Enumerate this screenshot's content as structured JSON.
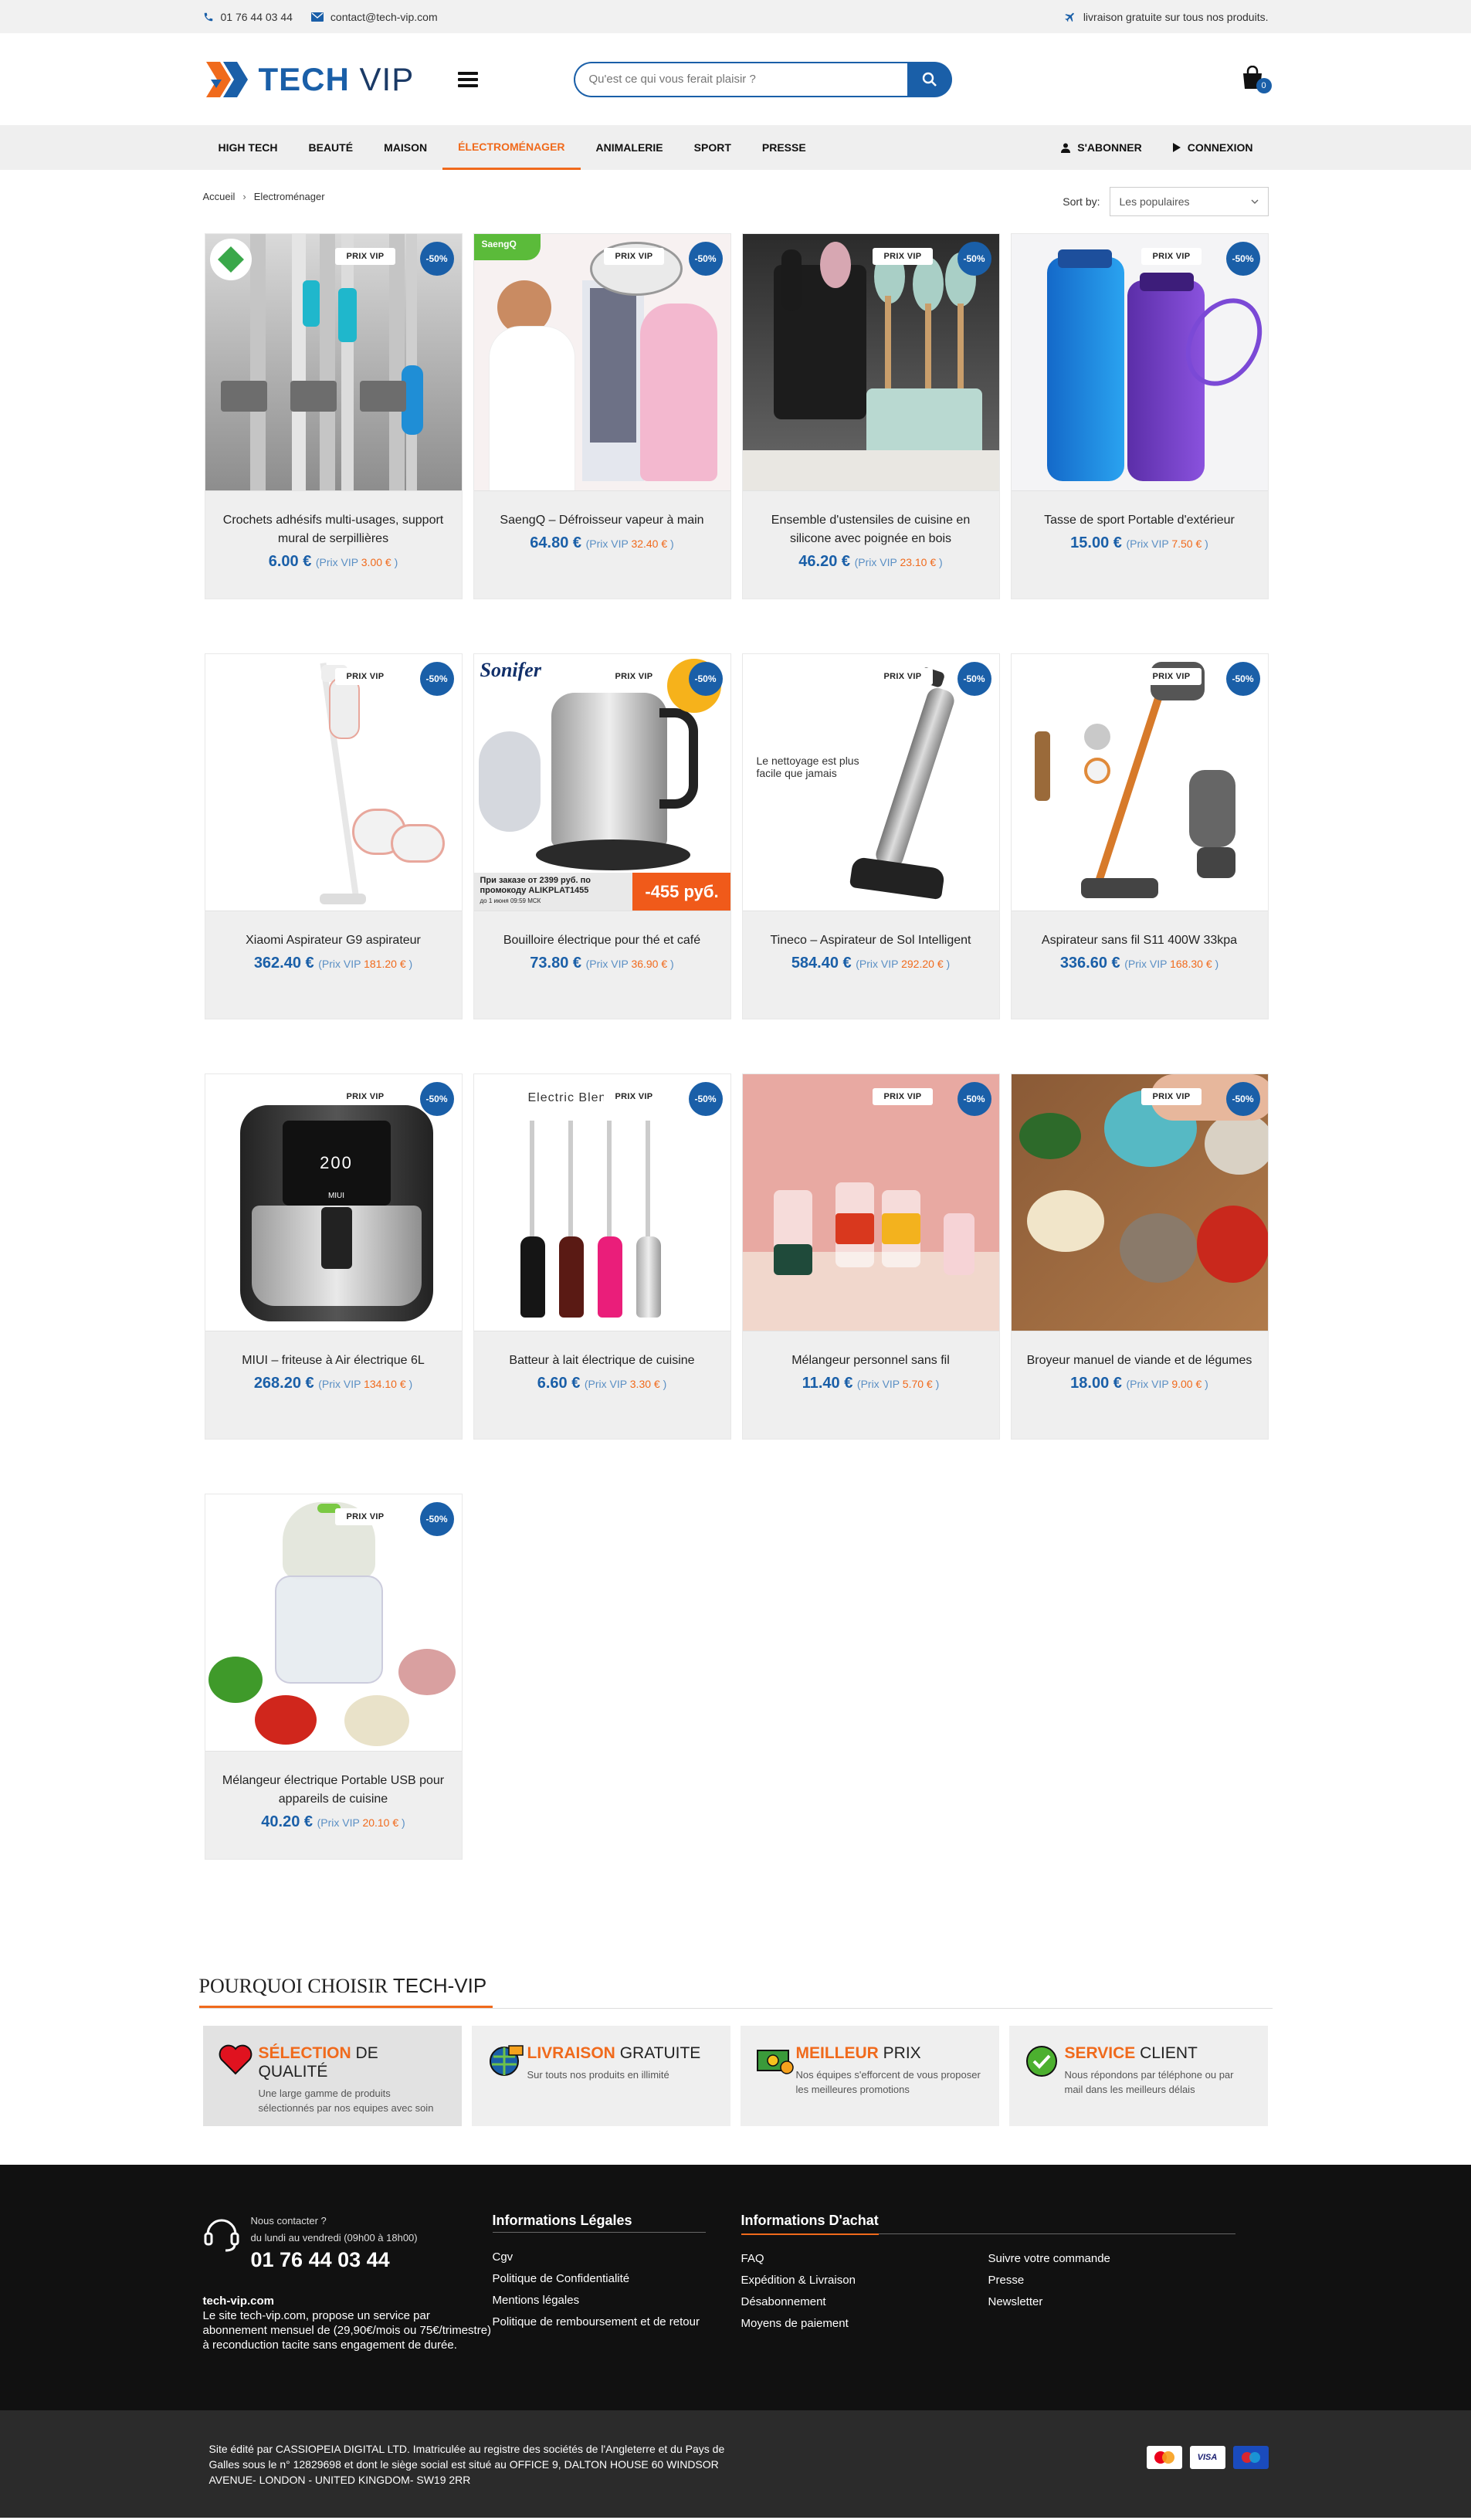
{
  "topbar": {
    "phone": "01 76 44 03 44",
    "email": "contact@tech-vip.com",
    "shipping": "livraison gratuite sur tous nos produits."
  },
  "header": {
    "logo_main": "TECH",
    "logo_sub": "VIP",
    "search_placeholder": "Qu'est ce qui vous ferait plaisir ?",
    "cart_count": "0"
  },
  "nav": {
    "items": [
      "HIGH TECH",
      "BEAUTÉ",
      "MAISON",
      "ÉLECTROMÉNAGER",
      "ANIMALERIE",
      "SPORT",
      "PRESSE"
    ],
    "active": "ÉLECTROMÉNAGER",
    "subscribe": "S'ABONNER",
    "login": "CONNEXION"
  },
  "breadcrumb": {
    "home": "Accueil",
    "sep": "›",
    "current": "Electroménager"
  },
  "sort": {
    "label": "Sort by:",
    "value": "Les populaires"
  },
  "product_labels": {
    "tag": "PRIX VIP",
    "discount": "-50%",
    "vip_prefix": "(Prix VIP",
    "vip_suffix": ")"
  },
  "products": [
    {
      "name": "Crochets adhésifs multi-usages, support mural de serpillières",
      "price": "6.00 €",
      "vip": "3.00 €",
      "img": "hooks"
    },
    {
      "name": "SaengQ – Défroisseur vapeur à main",
      "price": "64.80 €",
      "vip": "32.40 €",
      "img": "steamer"
    },
    {
      "name": "Ensemble d'ustensiles de cuisine en silicone avec poignée en bois",
      "price": "46.20 €",
      "vip": "23.10 €",
      "img": "utensils"
    },
    {
      "name": "Tasse de sport Portable d'extérieur",
      "price": "15.00 €",
      "vip": "7.50 €",
      "img": "bottles"
    },
    {
      "name": "Xiaomi Aspirateur G9 aspirateur",
      "price": "362.40 €",
      "vip": "181.20 €",
      "img": "vacuum-white"
    },
    {
      "name": "Bouilloire électrique pour thé et café",
      "price": "73.80 €",
      "vip": "36.90 €",
      "img": "kettle"
    },
    {
      "name": "Tineco – Aspirateur de Sol Intelligent",
      "price": "584.40 €",
      "vip": "292.20 €",
      "img": "floor-washer"
    },
    {
      "name": "Aspirateur sans fil S11 400W 33kpa",
      "price": "336.60 €",
      "vip": "168.30 €",
      "img": "vacuum-orange"
    },
    {
      "name": "MIUI – friteuse à Air électrique 6L",
      "price": "268.20 €",
      "vip": "134.10 €",
      "img": "airfryer"
    },
    {
      "name": "Batteur à lait électrique de cuisine",
      "price": "6.60 €",
      "vip": "3.30 €",
      "img": "frothers"
    },
    {
      "name": "Mélangeur personnel sans fil",
      "price": "11.40 €",
      "vip": "5.70 €",
      "img": "blenders"
    },
    {
      "name": "Broyeur manuel de viande et de légumes",
      "price": "18.00 €",
      "vip": "9.00 €",
      "img": "chopper"
    },
    {
      "name": "Mélangeur électrique Portable USB pour appareils de cuisine",
      "price": "40.20 €",
      "vip": "20.10 €",
      "img": "mini-chopper"
    }
  ],
  "image_text": {
    "saengq": "SaengQ",
    "sonifer": "Sonifer",
    "kettle_banner": "При заказе от 2399 руб. по промокоду ALIKPLAT1455",
    "kettle_banner_small": "до 1 июня 09:59 МСК",
    "kettle_price": "-455 руб.",
    "floor_text": "Le nettoyage est plus facile que jamais",
    "frother_text": "Electric Blen",
    "airfryer_display": "200",
    "airfryer_brand": "MIUI"
  },
  "why": {
    "title_serif": "POURQUOI CHOISIR",
    "title_brand": "TECH-VIP",
    "boxes": [
      {
        "accent": "SÉLECTION",
        "rest": "DE QUALITÉ",
        "desc": "Une large gamme de produits sélectionnés par nos equipes avec soin",
        "icon": "heart-icon"
      },
      {
        "accent": "LIVRAISON",
        "rest": "GRATUITE",
        "desc": "Sur touts nos produits en illimité",
        "icon": "globe-delivery-icon"
      },
      {
        "accent": "MEILLEUR",
        "rest": "PRIX",
        "desc": "Nos équipes s'efforcent de vous proposer les meilleures promotions",
        "icon": "money-icon"
      },
      {
        "accent": "SERVICE",
        "rest": "CLIENT",
        "desc": "Nous répondons par téléphone ou par mail dans les meilleurs délais",
        "icon": "check-icon"
      }
    ]
  },
  "footer": {
    "contact_label": "Nous contacter ?",
    "hours": "du lundi au vendredi (09h00 à 18h00)",
    "phone": "01 76 44 03 44",
    "site": "tech-vip.com",
    "site_desc": "Le site tech-vip.com, propose un service par abonnement mensuel de (29,90€/mois ou 75€/trimestre) à reconduction tacite sans engagement de durée.",
    "legal_title": "Informations Légales",
    "legal_links": [
      "Cgv",
      "Politique de Confidentialité",
      "Mentions légales",
      "Politique de remboursement et de retour"
    ],
    "achat_title": "Informations D'achat",
    "achat_links": [
      "FAQ",
      "Suivre votre commande",
      "Expédition & Livraison",
      "Presse",
      "Désabonnement",
      "Newsletter",
      "Moyens de paiement"
    ]
  },
  "bottom": {
    "legal": "Site édité par CASSIOPEIA DIGITAL LTD. Imatriculée au registre des sociétés de l'Angleterre et du Pays de Galles sous le n° 12829698 et dont le siège social est situé au OFFICE 9, DALTON HOUSE 60 WINDSOR AVENUE- LONDON - UNITED KINGDOM- SW19 2RR",
    "payments": [
      "MasterCard",
      "VISA",
      "Maestro"
    ]
  },
  "colors": {
    "brand_blue": "#1a5fa8",
    "accent_orange": "#f06a1c"
  }
}
